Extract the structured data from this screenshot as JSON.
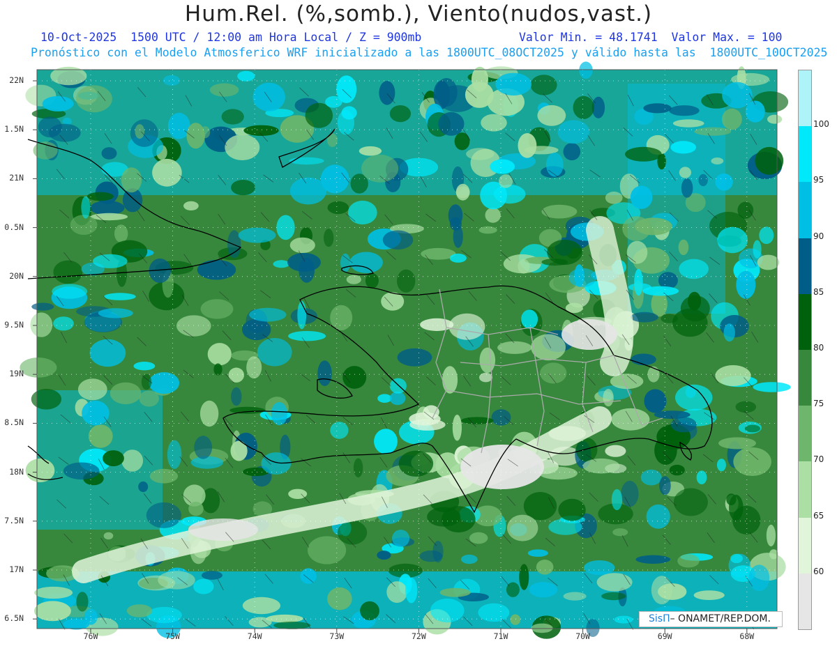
{
  "header": {
    "title": "Hum.Rel. (%,somb.), Viento(nudos,vast.)",
    "valid_line": "10-Oct-2025  1500 UTC / 12:00 am Hora Local / Z = 900mb",
    "minmax_line": "Valor Min. = 48.1741  Valor Max. = 100",
    "model_line": "Pronóstico con el Modelo Atmosferico WRF inicializado a las 1800UTC_08OCT2025 y válido hasta las  1800UTC_10OCT2025"
  },
  "axes": {
    "y_labels": [
      "22N",
      "1.5N",
      "21N",
      "0.5N",
      "20N",
      "9.5N",
      "19N",
      "8.5N",
      "18N",
      "7.5N",
      "17N",
      "6.5N"
    ],
    "x_labels": [
      "76W",
      "75W",
      "74W",
      "73W",
      "72W",
      "71W",
      "70W",
      "69W",
      "68W"
    ]
  },
  "colorbar": {
    "labels": [
      "100",
      "95",
      "90",
      "85",
      "80",
      "75",
      "70",
      "65",
      "60"
    ],
    "colors": [
      "#aef3f7",
      "#00e9fb",
      "#00bfe4",
      "#005d87",
      "#00610c",
      "#37883d",
      "#6eb66b",
      "#abdfa4",
      "#e0f5d9",
      "#e6e6e6"
    ]
  },
  "credit": {
    "sis": "SisΠ",
    "org": "– ONAMET/REP.DOM."
  },
  "map": {
    "colors": {
      "sea_light": "#00bfe4",
      "sea_cyan": "#00e9fb",
      "sea_dark": "#005d87",
      "green_dark": "#00610c",
      "green_mid": "#37883d",
      "green_light": "#6eb66b",
      "green_pale": "#abdfa4",
      "green_paler": "#e0f5d9",
      "grey": "#e6e6e6",
      "coast": "#000000",
      "provinces": "#aaaaaa"
    }
  }
}
